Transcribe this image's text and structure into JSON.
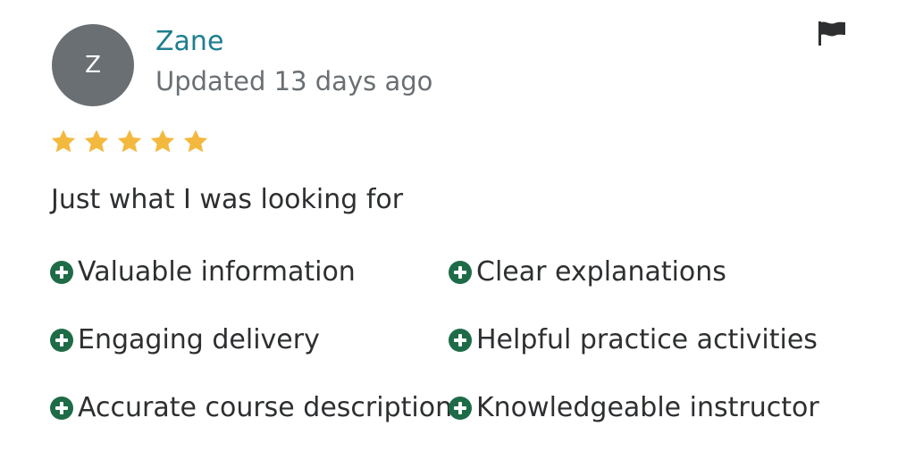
{
  "review": {
    "avatar_initial": "Z",
    "reviewer_name": "Zane",
    "updated": "Updated 13 days ago",
    "rating": 5,
    "rating_max": 5,
    "text": "Just what I was looking for",
    "tags": [
      "Valuable information",
      "Clear explanations",
      "Engaging delivery",
      "Helpful practice activities",
      "Accurate course description",
      "Knowledgeable instructor"
    ]
  },
  "icons": {
    "flag": "flag-icon",
    "star": "star-icon",
    "tag": "plus-circle-icon"
  },
  "colors": {
    "avatar_bg": "#6a6f73",
    "name": "#1e7e8e",
    "star": "#f3b93f",
    "tag_icon": "#1e6b48"
  }
}
